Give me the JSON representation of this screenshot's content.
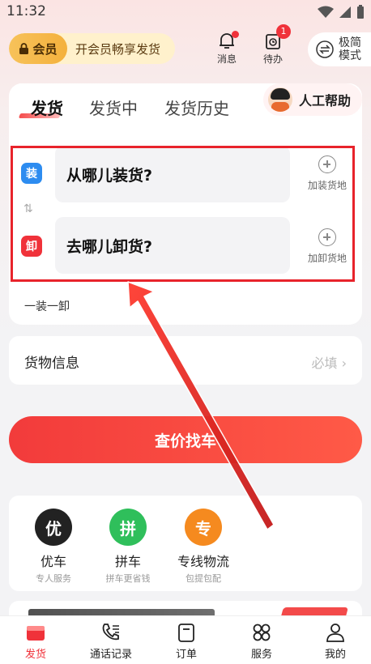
{
  "status_bar": {
    "time": "11:32"
  },
  "header": {
    "vip_badge": "会员",
    "vip_text": "开会员畅享发货",
    "messages_label": "消息",
    "todo_label": "待办",
    "todo_count": "1",
    "mode_label_line1": "极简",
    "mode_label_line2": "模式"
  },
  "tabs": [
    {
      "label": "发货",
      "active": true
    },
    {
      "label": "发货中",
      "active": false
    },
    {
      "label": "发货历史",
      "active": false
    }
  ],
  "help_button": "人工帮助",
  "shipping": {
    "load": {
      "tag": "装",
      "placeholder": "从哪儿装货?",
      "add_label": "加装货地"
    },
    "unload": {
      "tag": "卸",
      "placeholder": "去哪儿卸货?",
      "add_label": "加卸货地"
    },
    "route_mode": "一装一卸"
  },
  "goods": {
    "label": "货物信息",
    "value": "必填"
  },
  "cta_label": "查价找车",
  "services": [
    {
      "icon_char": "优",
      "title": "优车",
      "subtitle": "专人服务",
      "color": "#222222"
    },
    {
      "icon_char": "拼",
      "title": "拼车",
      "subtitle": "拼车更省钱",
      "color": "#2fbf5b"
    },
    {
      "icon_char": "专",
      "title": "专线物流",
      "subtitle": "包提包配",
      "color": "#f58a1f"
    }
  ],
  "bottom_nav": [
    {
      "label": "发货",
      "icon": "truck-icon",
      "active": true
    },
    {
      "label": "通话记录",
      "icon": "phone-list-icon",
      "active": false
    },
    {
      "label": "订单",
      "icon": "order-icon",
      "active": false
    },
    {
      "label": "服务",
      "icon": "grid-icon",
      "active": false
    },
    {
      "label": "我的",
      "icon": "person-icon",
      "active": false
    }
  ],
  "colors": {
    "accent": "#f0323a",
    "load_tag": "#2d8cf0",
    "unload_tag": "#f0323a",
    "vip": "#f4b13d"
  }
}
